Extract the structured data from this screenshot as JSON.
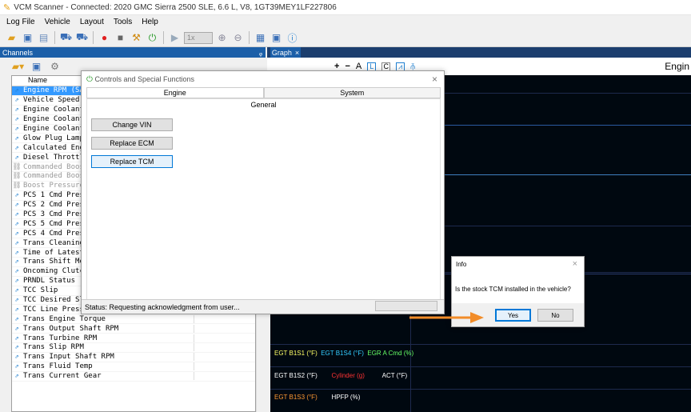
{
  "window": {
    "title": "VCM Scanner - Connected: 2020 GMC Sierra 2500 SLE, 6.6 L, V8, 1GT39MEY1LF227806"
  },
  "menu": [
    "Log File",
    "Vehicle",
    "Layout",
    "Tools",
    "Help"
  ],
  "toolbar": {
    "zoom_combo": "1x"
  },
  "channels": {
    "header": "Channels",
    "pin": "ᵩ",
    "column": "Name",
    "rows": [
      {
        "name": "Engine RPM (SAE)",
        "selected": true
      },
      {
        "name": "Vehicle Speed"
      },
      {
        "name": "Engine Coolant Temp"
      },
      {
        "name": "Engine Coolant Temp 2"
      },
      {
        "name": "Engine Coolant Temp 3"
      },
      {
        "name": "Glow Plug Lamp"
      },
      {
        "name": "Calculated Engine Load"
      },
      {
        "name": "Diesel Throttle"
      },
      {
        "name": "Commanded Boost",
        "disabled": true
      },
      {
        "name": "Commanded Boost",
        "disabled": true
      },
      {
        "name": "Boost Pressure",
        "disabled": true
      },
      {
        "name": "PCS 1 Cmd Pressure"
      },
      {
        "name": "PCS 2 Cmd Pressure"
      },
      {
        "name": "PCS 3 Cmd Pressure"
      },
      {
        "name": "PCS 5 Cmd Pressure"
      },
      {
        "name": "PCS 4 Cmd Pressure"
      },
      {
        "name": "Trans Cleaning"
      },
      {
        "name": "Time of Latest Shift"
      },
      {
        "name": "Trans Shift Mode"
      },
      {
        "name": "Oncoming Clutch"
      },
      {
        "name": "PRNDL Status"
      },
      {
        "name": "TCC Slip"
      },
      {
        "name": "TCC Desired Slip"
      },
      {
        "name": "TCC Line Pressure"
      },
      {
        "name": "Trans Engine Torque"
      },
      {
        "name": "Trans Output Shaft RPM"
      },
      {
        "name": "Trans Turbine RPM"
      },
      {
        "name": "Trans Slip RPM"
      },
      {
        "name": "Trans Input Shaft RPM"
      },
      {
        "name": "Trans Fluid Temp"
      },
      {
        "name": "Trans Current Gear"
      }
    ]
  },
  "graph": {
    "tab": "Graph",
    "tab_close": "×",
    "tools": [
      "+",
      "−",
      "A",
      "L",
      "C"
    ],
    "title": "Engin",
    "legend_row1": [
      {
        "text": "EGT B1S1 (°F)",
        "color": "#ffff66"
      },
      {
        "text": "EGT B1S4 (°F)",
        "color": "#33ccff"
      },
      {
        "text": "EGR A Cmd (%)",
        "color": "#66ff66"
      }
    ],
    "legend_row2": [
      {
        "text": "EGT B1S2 (°F)",
        "color": "#ffffff"
      },
      {
        "text": "Cylinder (g)",
        "color": "#ff3333"
      },
      {
        "text": "ACT (°F)",
        "color": "#ffffff"
      }
    ],
    "legend_row3": [
      {
        "text": "EGT B1S3 (°F)",
        "color": "#ff9933"
      },
      {
        "text": "HPFP (%)",
        "color": "#ffffff"
      }
    ]
  },
  "controls_dialog": {
    "title": "Controls and Special Functions",
    "close": "×",
    "tabs": [
      "Engine",
      "System"
    ],
    "group": "General",
    "buttons": [
      "Change VIN",
      "Replace ECM",
      "Replace TCM"
    ],
    "status": "Status: Requesting acknowledgment from user..."
  },
  "info_dialog": {
    "title": "Info",
    "close": "×",
    "message": "Is the stock TCM installed in the vehicle?",
    "yes": "Yes",
    "no": "No"
  },
  "colors": {
    "accent": "#1c5fa8",
    "selection": "#3399ff",
    "arrow": "#f28c28",
    "graph_bg": "#000810"
  }
}
